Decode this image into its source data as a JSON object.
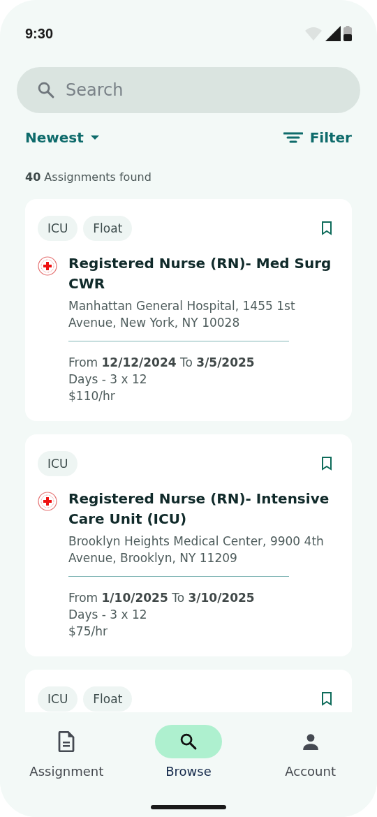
{
  "status_bar": {
    "time": "9:30"
  },
  "search": {
    "placeholder": "Search"
  },
  "sort": {
    "label": "Newest"
  },
  "filter": {
    "label": "Filter"
  },
  "result_count": "**40** Assignments found",
  "assignments": [
    {
      "tags": [
        "ICU",
        "Float"
      ],
      "title": "Registered Nurse (RN)- Med Surg CWR",
      "address": "Manhattan General Hospital, 1455 1st Avenue, New York, NY 10028",
      "dates": "From **12/12/2024** To **3/5/2025**",
      "shift": "Days - 3 x 12",
      "rate": "$110/hr"
    },
    {
      "tags": [
        "ICU"
      ],
      "title": "Registered Nurse (RN)- Intensive Care Unit (ICU)",
      "address": "Brooklyn Heights Medical Center, 9900 4th Avenue, Brooklyn, NY 11209",
      "dates": "From **1/10/2025** To **3/10/2025**",
      "shift": "Days - 3 x 12",
      "rate": "$75/hr"
    },
    {
      "tags": [
        "ICU",
        "Float"
      ]
    }
  ],
  "bottom_nav": [
    {
      "kind": "document",
      "label": "Assignment",
      "selected": false
    },
    {
      "kind": "search",
      "label": "Browse",
      "selected": true
    },
    {
      "kind": "person",
      "label": "Account",
      "selected": false
    }
  ]
}
